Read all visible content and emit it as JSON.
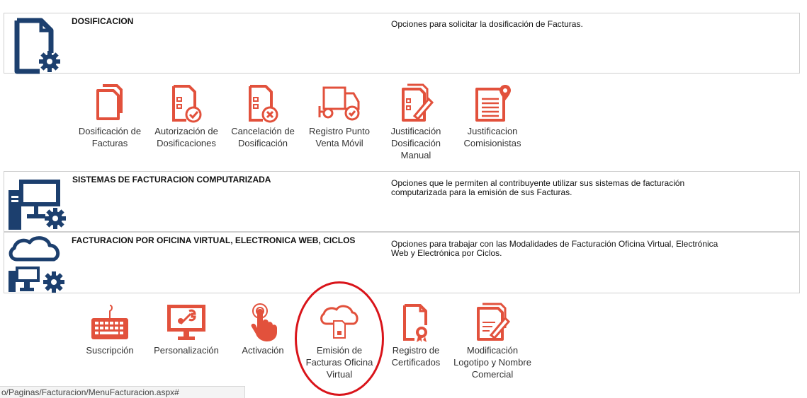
{
  "colors": {
    "accent_red": "#e2513c",
    "navy": "#1c3f6e",
    "circle": "#d9141a"
  },
  "sections": {
    "dosificacion": {
      "title": "DOSIFICACION",
      "description": "Opciones para solicitar la dosificación de Facturas.",
      "icon": "document-gear-icon"
    },
    "sistemas": {
      "title": "SISTEMAS DE FACTURACION COMPUTARIZADA",
      "description": "Opciones que le permiten al contribuyente utilizar sus sistemas de facturación computarizada para la emisión de sus Facturas.",
      "icon": "computer-gear-icon"
    },
    "oficina_virtual": {
      "title": "FACTURACION POR OFICINA VIRTUAL, ELECTRONICA WEB, CICLOS",
      "description": "Opciones para trabajar con las Modalidades de Facturación Oficina Virtual, Electrónica Web y Electrónica por Ciclos.",
      "icon": "cloud-computer-gear-icon"
    }
  },
  "dosificacion_options": [
    {
      "label": "Dosificación de Facturas",
      "icon": "documents-stack-icon"
    },
    {
      "label": "Autorización de Dosificaciones",
      "icon": "document-check-icon"
    },
    {
      "label": "Cancelación de Dosificación",
      "icon": "document-cancel-icon"
    },
    {
      "label": "Registro Punto Venta Móvil",
      "icon": "truck-icon"
    },
    {
      "label": "Justificación Dosificación Manual",
      "icon": "document-pen-icon"
    },
    {
      "label": "Justificacion Comisionistas",
      "icon": "document-location-icon"
    }
  ],
  "virtual_options": [
    {
      "label": "Suscripción",
      "icon": "keyboard-icon"
    },
    {
      "label": "Personalización",
      "icon": "monitor-tools-icon"
    },
    {
      "label": "Activación",
      "icon": "hand-touch-icon"
    },
    {
      "label": "Emisión de Facturas Oficina Virtual",
      "icon": "cloud-document-icon"
    },
    {
      "label": "Registro de Certificados",
      "icon": "certificate-icon"
    },
    {
      "label": "Modificación Logotipo y Nombre Comercial",
      "icon": "document-edit-icon"
    }
  ],
  "status_bar": {
    "url": "o/Paginas/Facturacion/MenuFacturacion.aspx#"
  }
}
